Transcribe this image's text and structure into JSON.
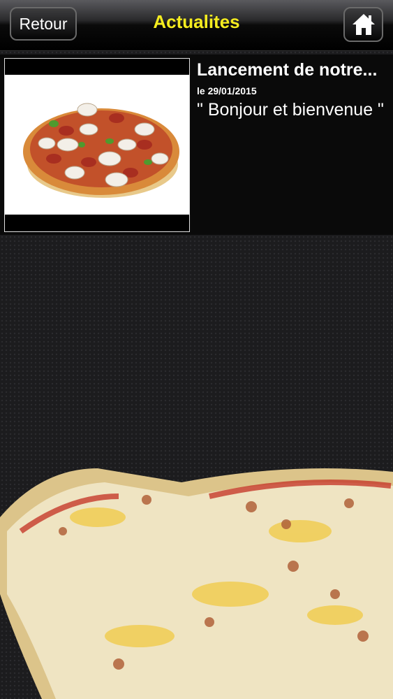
{
  "header": {
    "back_label": "Retour",
    "title": "Actualites",
    "home_icon": "home-icon"
  },
  "news": [
    {
      "title": "Lancement de notre...",
      "date": "le 29/01/2015",
      "excerpt": "\" Bonjour et bienvenue \"",
      "image": "pizza-image"
    }
  ],
  "colors": {
    "title_yellow": "#f4ec1f",
    "background": "#1c1c1e"
  }
}
